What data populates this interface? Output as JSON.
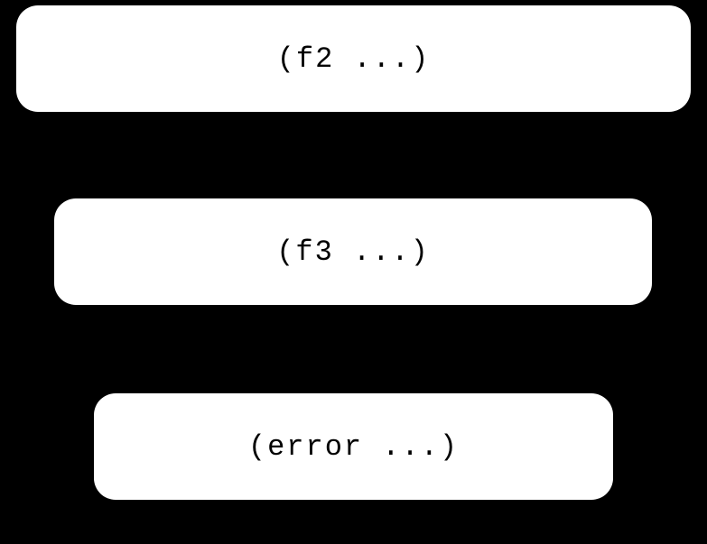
{
  "boxes": [
    {
      "label": "(f2 ...)"
    },
    {
      "label": "(f3 ...)"
    },
    {
      "label": "(error ...)"
    }
  ]
}
